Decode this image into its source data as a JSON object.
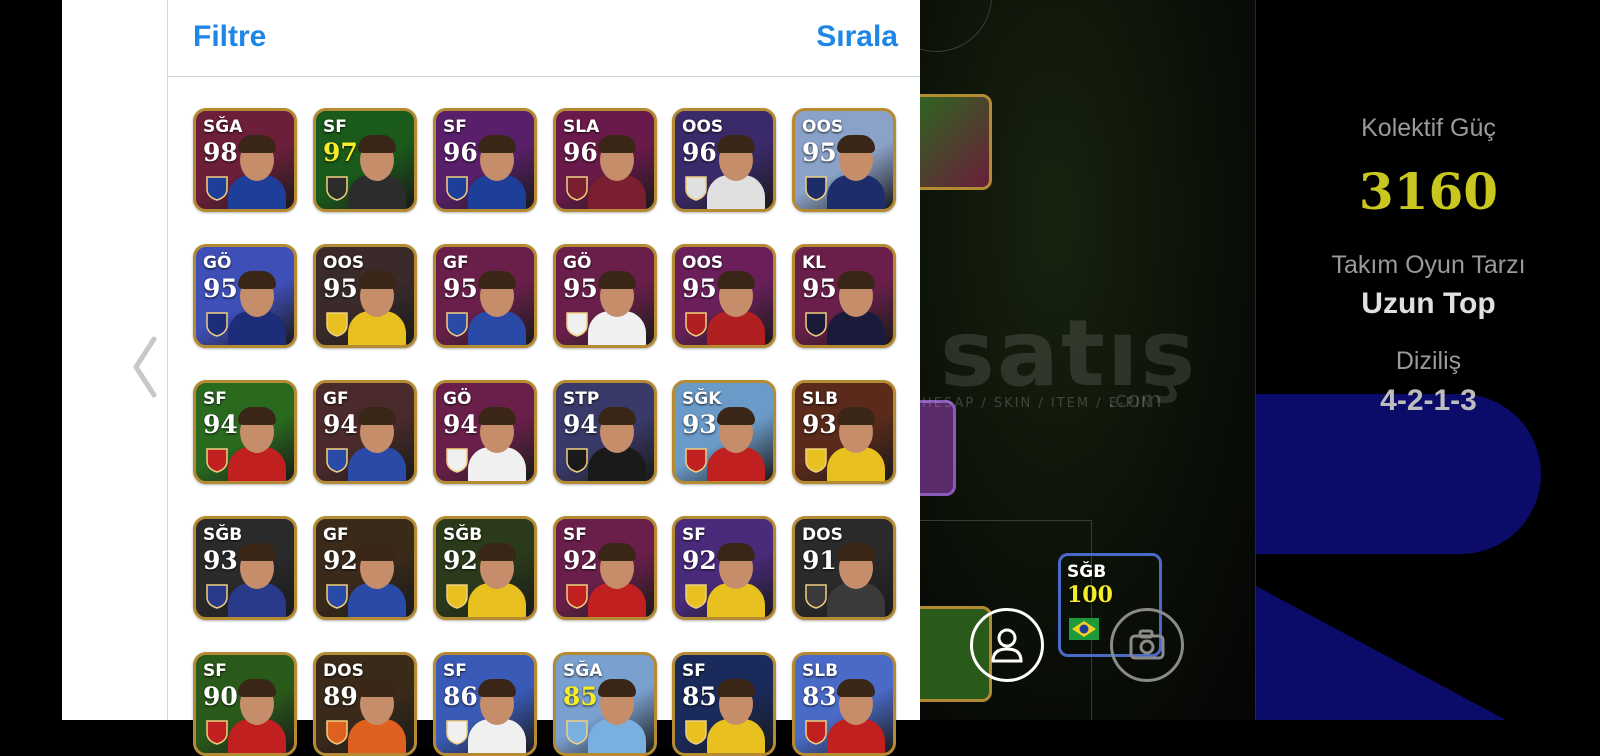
{
  "header": {
    "filter_label": "Filtre",
    "sort_label": "Sırala"
  },
  "players": [
    {
      "pos": "SĞA",
      "rating": "98",
      "bg": "#6d1f3a",
      "accent": "#1d3f9a",
      "yellow": false
    },
    {
      "pos": "SF",
      "rating": "97",
      "bg": "#1a5a1a",
      "accent": "#2c2c2c",
      "yellow": true
    },
    {
      "pos": "SF",
      "rating": "96",
      "bg": "#5a1f6a",
      "accent": "#1d3f9a",
      "yellow": false
    },
    {
      "pos": "SLA",
      "rating": "96",
      "bg": "#6a1a4a",
      "accent": "#7a1f2f",
      "yellow": false
    },
    {
      "pos": "OOS",
      "rating": "96",
      "bg": "#3a2a6a",
      "accent": "#e0e0e0",
      "yellow": false
    },
    {
      "pos": "OOS",
      "rating": "95",
      "bg": "#8aa2c8",
      "accent": "#1d2d6a",
      "yellow": false
    },
    {
      "pos": "GÖ",
      "rating": "95",
      "bg": "#3f4fb8",
      "accent": "#1d2d7a",
      "yellow": false
    },
    {
      "pos": "OOS",
      "rating": "95",
      "bg": "#3a2a2a",
      "accent": "#e8c020",
      "yellow": false
    },
    {
      "pos": "GF",
      "rating": "95",
      "bg": "#6a1f4a",
      "accent": "#2a4aa8",
      "yellow": false
    },
    {
      "pos": "GÖ",
      "rating": "95",
      "bg": "#6a1f4a",
      "accent": "#f0f0f0",
      "yellow": false
    },
    {
      "pos": "OOS",
      "rating": "95",
      "bg": "#6a1f5a",
      "accent": "#b02020",
      "yellow": false
    },
    {
      "pos": "KL",
      "rating": "95",
      "bg": "#6a1f4a",
      "accent": "#1a1a3a",
      "yellow": false
    },
    {
      "pos": "SF",
      "rating": "94",
      "bg": "#2a6a1f",
      "accent": "#c02020",
      "yellow": false
    },
    {
      "pos": "GF",
      "rating": "94",
      "bg": "#4a2a2a",
      "accent": "#2a4aa8",
      "yellow": false
    },
    {
      "pos": "GÖ",
      "rating": "94",
      "bg": "#6a1f4a",
      "accent": "#f0f0f0",
      "yellow": false
    },
    {
      "pos": "STP",
      "rating": "94",
      "bg": "#3a3a6a",
      "accent": "#1a1a1a",
      "yellow": false
    },
    {
      "pos": "SĞK",
      "rating": "93",
      "bg": "#6a9ac8",
      "accent": "#c02020",
      "yellow": false
    },
    {
      "pos": "SLB",
      "rating": "93",
      "bg": "#5a2a1a",
      "accent": "#e8c020",
      "yellow": false
    },
    {
      "pos": "SĞB",
      "rating": "93",
      "bg": "#2a2a2a",
      "accent": "#2a3a8a",
      "yellow": false
    },
    {
      "pos": "GF",
      "rating": "92",
      "bg": "#3a2a1a",
      "accent": "#2a4aa8",
      "yellow": false
    },
    {
      "pos": "SĞB",
      "rating": "92",
      "bg": "#2a3a1a",
      "accent": "#e8c020",
      "yellow": false
    },
    {
      "pos": "SF",
      "rating": "92",
      "bg": "#6a1f4a",
      "accent": "#c02020",
      "yellow": false
    },
    {
      "pos": "SF",
      "rating": "92",
      "bg": "#4a2a7a",
      "accent": "#e8c020",
      "yellow": false
    },
    {
      "pos": "DOS",
      "rating": "91",
      "bg": "#2a2a2a",
      "accent": "#3a3a3a",
      "yellow": false
    },
    {
      "pos": "SF",
      "rating": "90",
      "bg": "#2a5a1a",
      "accent": "#c02020",
      "yellow": false
    },
    {
      "pos": "DOS",
      "rating": "89",
      "bg": "#3a2a1a",
      "accent": "#e06020",
      "yellow": false
    },
    {
      "pos": "SF",
      "rating": "86",
      "bg": "#3a5ab8",
      "accent": "#f0f0f0",
      "yellow": false
    },
    {
      "pos": "SĞA",
      "rating": "85",
      "bg": "#7aa0d0",
      "accent": "#7ab0e0",
      "yellow": true
    },
    {
      "pos": "SF",
      "rating": "85",
      "bg": "#1a2a5a",
      "accent": "#e8c020",
      "yellow": false
    },
    {
      "pos": "SLB",
      "rating": "83",
      "bg": "#4a6ac8",
      "accent": "#c02020",
      "yellow": false
    }
  ],
  "field": {
    "cards": [
      {
        "pos": "SĞB",
        "rating": "100",
        "bg": "#3a5ab8"
      }
    ],
    "watermark": "satış",
    "watermark_sub": "HESAP / SKIN / ITEM / E-PIN",
    "watermark_com": ".com",
    "profile_icon": "person-icon",
    "camera_icon": "camera-icon"
  },
  "info": {
    "power_label": "Kolektif Güç",
    "power_value": "3160",
    "style_label": "Takım Oyun Tarzı",
    "style_value": "Uzun Top",
    "formation_label": "Diziliş",
    "formation_value": "4-2-1-3"
  },
  "colors": {
    "accent_blue": "#1e86e6",
    "power_yellow": "#c9c61f",
    "card_gold": "#b48a33"
  }
}
